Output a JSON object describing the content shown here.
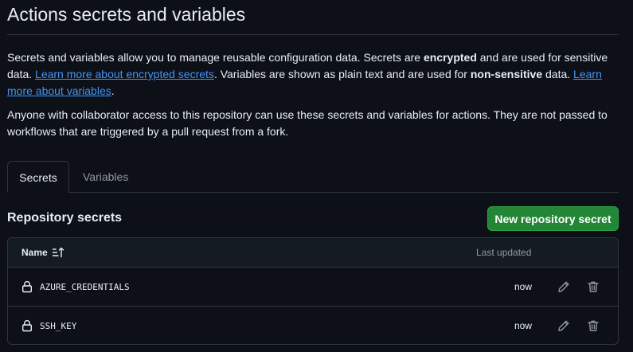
{
  "page": {
    "title": "Actions secrets and variables",
    "intro": {
      "t1": "Secrets and variables allow you to manage reusable configuration data. Secrets are ",
      "b1": "encrypted",
      "t2": " and are used for sensitive data. ",
      "link1": "Learn more about encrypted secrets",
      "t3": ". Variables are shown as plain text and are used for ",
      "b2": "non-sensitive",
      "t4": " data. ",
      "link2": "Learn more about variables",
      "t5": "."
    },
    "note": "Anyone with collaborator access to this repository can use these secrets and variables for actions. They are not passed to workflows that are triggered by a pull request from a fork."
  },
  "tabs": [
    {
      "label": "Secrets",
      "active": true
    },
    {
      "label": "Variables",
      "active": false
    }
  ],
  "section": {
    "title": "Repository secrets",
    "new_button": "New repository secret"
  },
  "table": {
    "col_name": "Name",
    "col_updated": "Last updated",
    "rows": [
      {
        "name": "AZURE_CREDENTIALS",
        "updated": "now"
      },
      {
        "name": "SSH_KEY",
        "updated": "now"
      }
    ]
  },
  "icons": {
    "sort": "sort-ascending-icon",
    "lock": "lock-icon",
    "edit": "pencil-icon",
    "delete": "trash-icon"
  },
  "colors": {
    "background": "#0d1117",
    "link": "#4493f8",
    "primary_button": "#238636",
    "border": "#30363d",
    "muted_text": "#9198a1"
  }
}
